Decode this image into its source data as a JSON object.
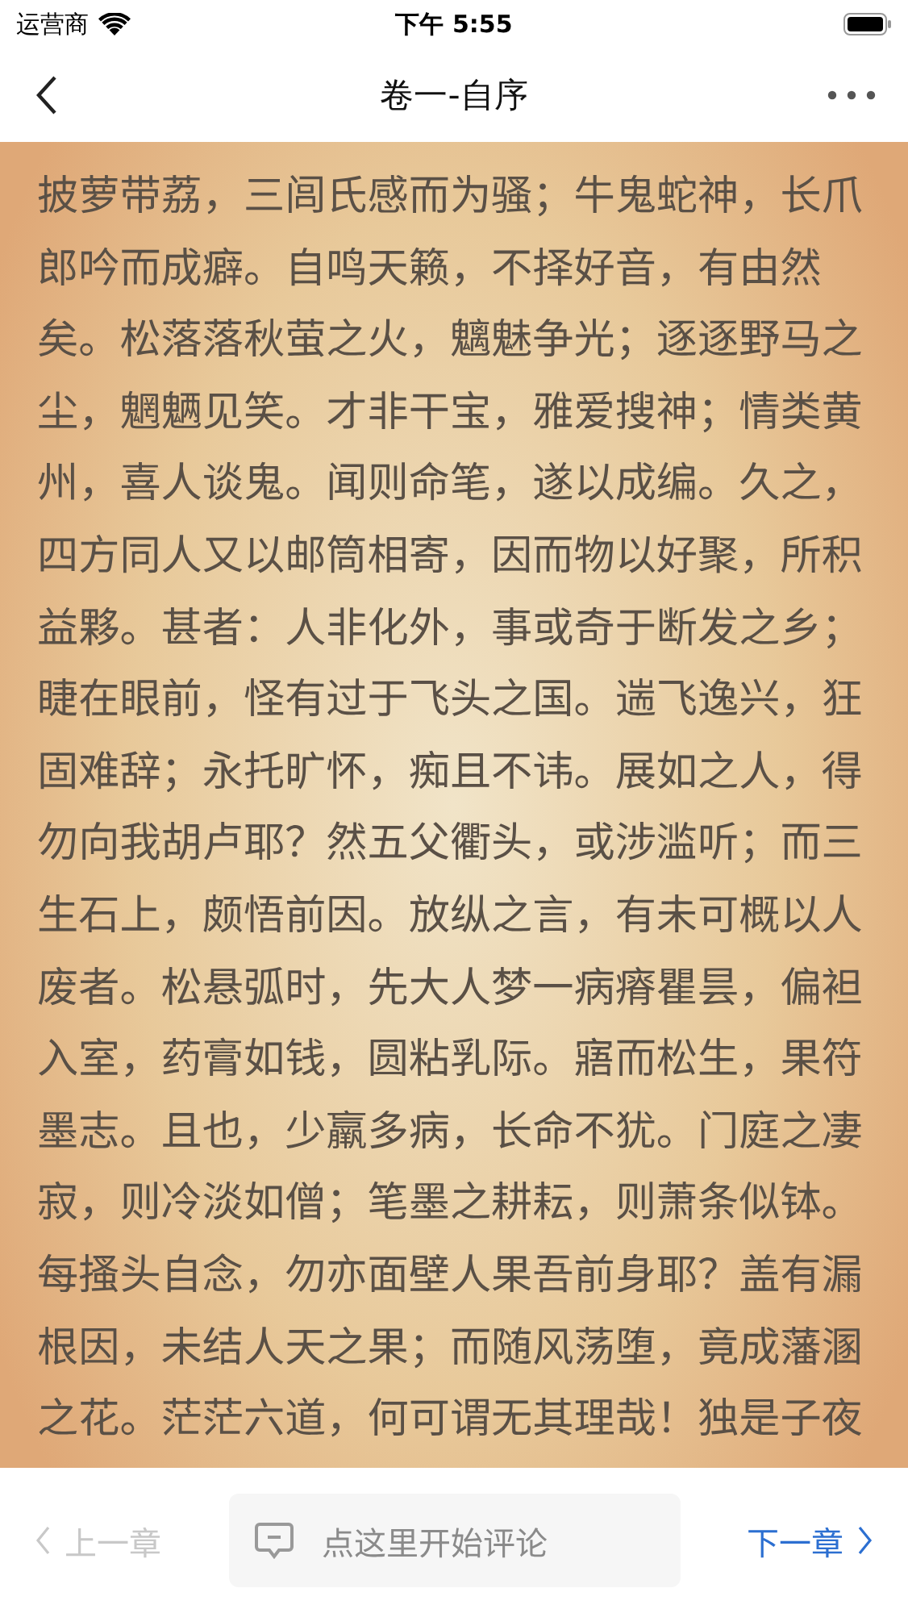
{
  "status_bar": {
    "carrier": "运营商",
    "time": "下午 5:55"
  },
  "nav": {
    "title": "卷一-自序"
  },
  "content": {
    "lines": [
      "披萝带荔，三闾氏感而为骚；牛鬼蛇神，长爪",
      "郎吟而成癖。自鸣天籁，不择好音，有由然",
      "矣。松落落秋萤之火，魑魅争光；逐逐野马之",
      "尘，魍魉见笑。才非干宝，雅爱搜神；情类黄",
      "州，喜人谈鬼。闻则命笔，遂以成编。久之，",
      "四方同人又以邮筒相寄，因而物以好聚，所积",
      "益夥。甚者：人非化外，事或奇于断发之乡；",
      "睫在眼前，怪有过于飞头之国。遄飞逸兴，狂",
      "固难辞；永托旷怀，痴且不讳。展如之人，得",
      "勿向我胡卢耶？然五父衢头，或涉滥听；而三",
      "生石上，颇悟前因。放纵之言，有未可概以人",
      "废者。松悬弧时，先大人梦一病瘠瞿昙，偏袒",
      "入室，药膏如钱，圆粘乳际。寤而松生，果符",
      "墨志。且也，少羸多病，长命不犹。门庭之凄",
      "寂，则冷淡如僧；笔墨之耕耘，则萧条似钵。",
      "每搔头自念，勿亦面壁人果吾前身耶？盖有漏",
      "根因，未结人天之果；而随风荡堕，竟成藩溷",
      "之花。茫茫六道，何可谓无其理哉！独是子夜"
    ]
  },
  "bottom_bar": {
    "prev": {
      "label": "上一章",
      "disabled": true
    },
    "comment": {
      "placeholder": "点这里开始评论"
    },
    "next": {
      "label": "下一章",
      "disabled": false
    }
  }
}
